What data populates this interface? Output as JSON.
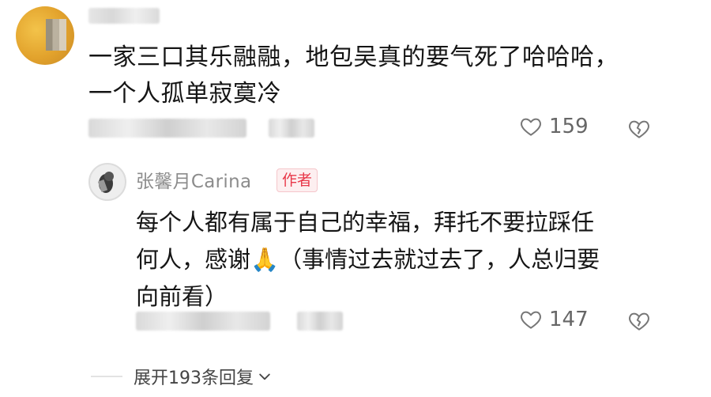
{
  "comment": {
    "text_line1": "一家三口其乐融融，地包吴真的要气死了哈哈哈，",
    "text_line2": "一个人孤单寂寞冷",
    "likes": "159"
  },
  "reply": {
    "author": "张馨月Carina",
    "badge": "作者",
    "text_line1": "每个人都有属于自己的幸福，拜托不要拉踩任",
    "text_line2": "何人，感谢🙏（事情过去就过去了，人总归要",
    "text_line3": "向前看）",
    "likes": "147"
  },
  "expand": {
    "label": "展开193条回复"
  },
  "colors": {
    "badge": "#e8394a",
    "meta": "#8c8c8c"
  }
}
